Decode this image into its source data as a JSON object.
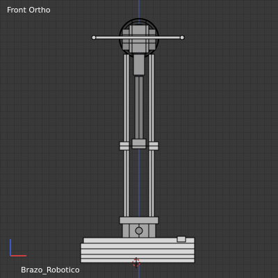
{
  "viewport": {
    "view_name": "Front Ortho",
    "object_name": "Brazo_Robotico",
    "colors": {
      "background": "#393939",
      "grid": "#333333",
      "wire": "#000000",
      "mesh_light": "#d8d8d8",
      "mesh_mid": "#b0b0b0",
      "z_axis": "#4f6dd8",
      "x_axis": "#d84a4a",
      "axis_blue": "#3b57c8",
      "axis_red": "#c84040"
    },
    "icons": {
      "axis_gizmo": "axis-gizmo-icon",
      "cursor": "3d-cursor-icon"
    }
  }
}
